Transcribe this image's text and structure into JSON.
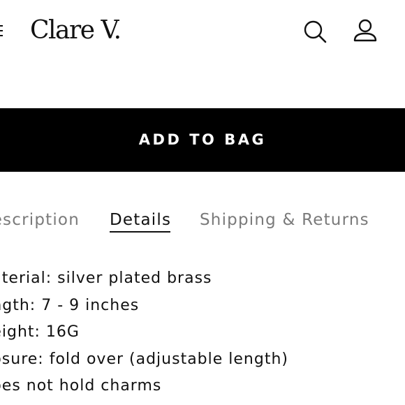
{
  "header": {
    "logo_text": "Clare V.",
    "menu_icon": "hamburger-menu-icon",
    "search_icon": "search-icon",
    "account_icon": "user-account-icon"
  },
  "product": {
    "add_to_bag_label": "ADD TO BAG"
  },
  "tabs": [
    {
      "label": "Description",
      "visible_text": "escription",
      "active": false
    },
    {
      "label": "Details",
      "active": true
    },
    {
      "label": "Shipping & Returns",
      "active": false
    }
  ],
  "details": [
    {
      "visible_text": "aterial: silver plated brass"
    },
    {
      "visible_text": "ngth: 7 - 9 inches"
    },
    {
      "visible_text": "eight: 16G"
    },
    {
      "visible_text": "osure: fold over (adjustable length)"
    },
    {
      "visible_text": "oes not hold charms"
    }
  ],
  "colors": {
    "primary_text": "#111111",
    "inactive_tab": "#7a7a7a",
    "button_bg": "#000000",
    "button_text": "#ffffff",
    "background": "#ffffff"
  }
}
